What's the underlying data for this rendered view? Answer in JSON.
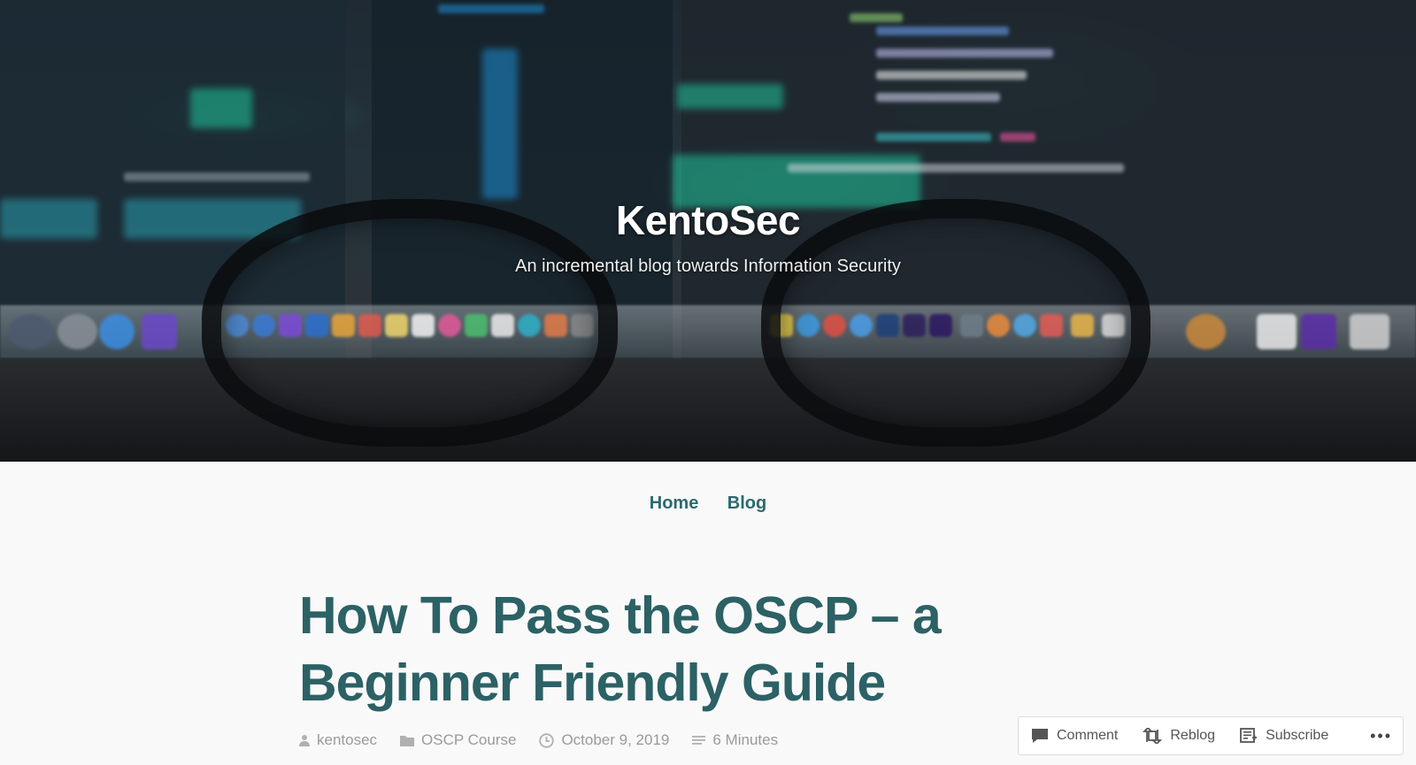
{
  "site": {
    "title": "KentoSec",
    "tagline": "An incremental blog towards Information Security"
  },
  "nav": {
    "items": [
      {
        "label": "Home"
      },
      {
        "label": "Blog"
      }
    ]
  },
  "post": {
    "title": "How To Pass the OSCP – a Beginner Friendly Guide",
    "meta": {
      "author": "kentosec",
      "category": "OSCP Course",
      "date": "October 9, 2019",
      "reading_time": "6 Minutes"
    }
  },
  "action_bar": {
    "comment": "Comment",
    "reblog": "Reblog",
    "subscribe": "Subscribe",
    "more": "•••"
  },
  "icons": {
    "author": "person-icon",
    "category": "folder-icon",
    "date": "clock-icon",
    "reading_time": "lines-icon",
    "comment": "speech-bubble-icon",
    "reblog": "reblog-icon",
    "subscribe": "reader-icon",
    "more": "ellipsis-icon"
  },
  "colors": {
    "accent": "#2a6a6f",
    "title": "#2c6165",
    "meta": "#9a9a9a",
    "background": "#f9f9f9"
  }
}
